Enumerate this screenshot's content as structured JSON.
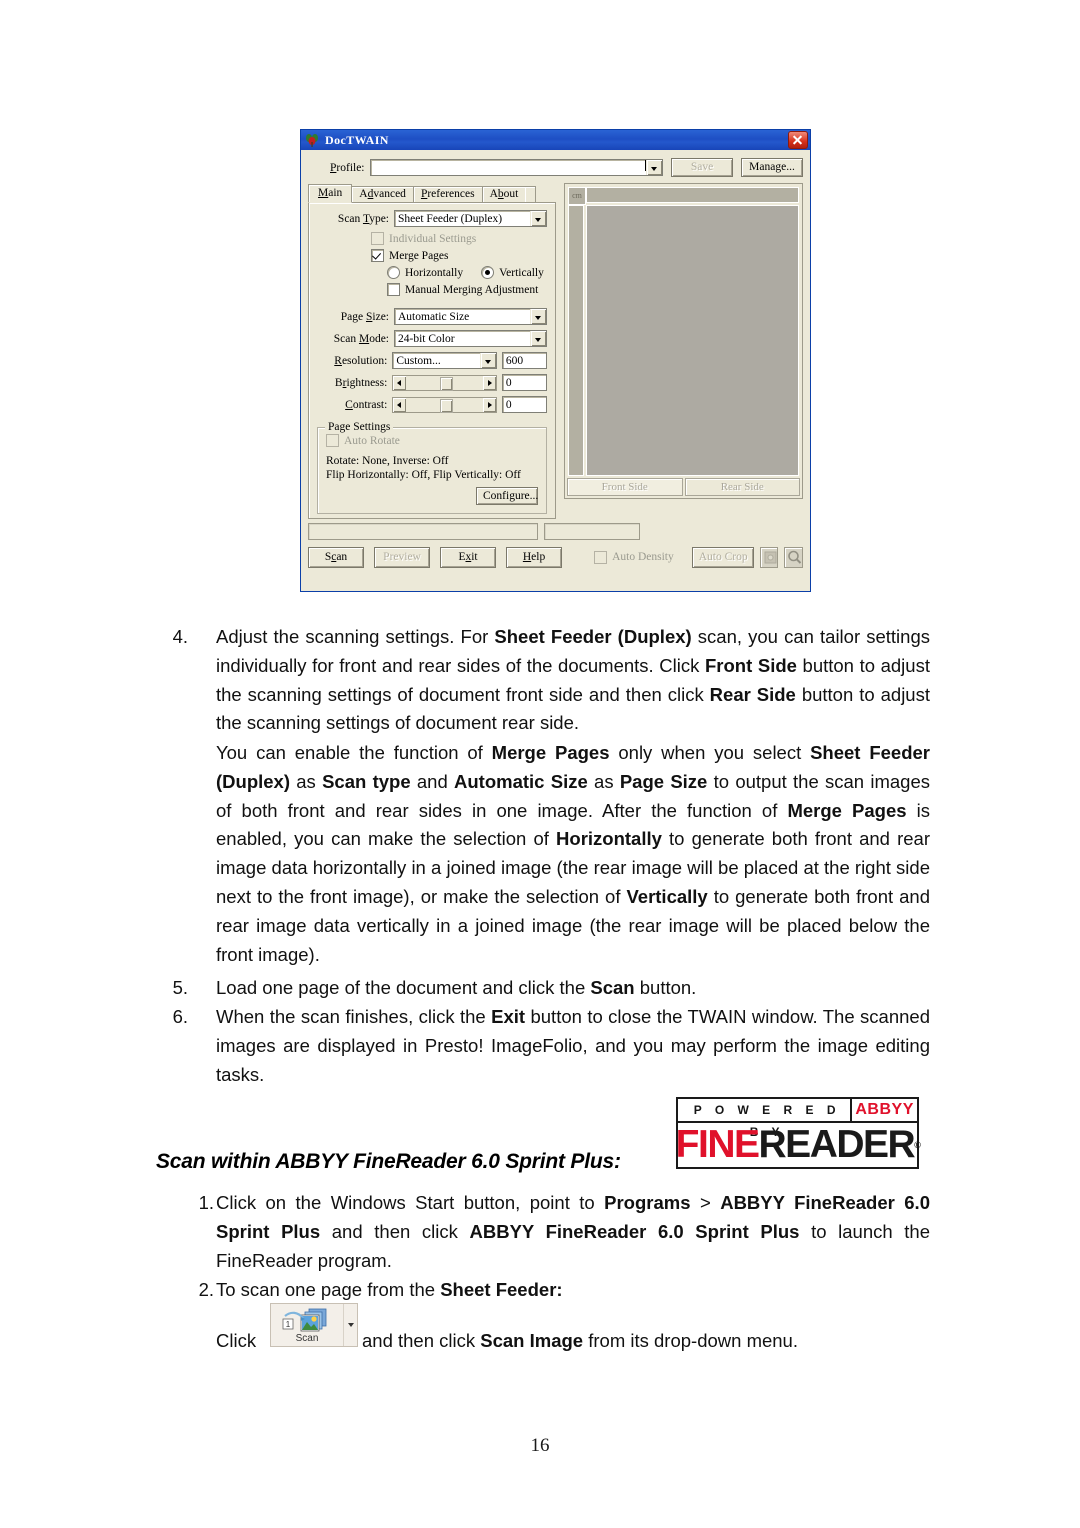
{
  "dialog": {
    "title": "DocTWAIN",
    "close_label": "Close",
    "profile_label": "Profile:",
    "profile_value": "",
    "save_label": "Save",
    "manage_label": "Manage...",
    "tabs": [
      {
        "label": "Main",
        "active": true
      },
      {
        "label": "Advanced",
        "active": false
      },
      {
        "label": "Preferences",
        "active": false
      },
      {
        "label": "About",
        "active": false
      }
    ],
    "main_tab": {
      "scan_type_label": "Scan Type:",
      "scan_type_value": "Sheet Feeder (Duplex)",
      "individual_settings_label": "Individual Settings",
      "individual_settings_checked": false,
      "merge_pages_label": "Merge Pages",
      "merge_pages_checked": true,
      "horizontally_label": "Horizontally",
      "vertically_label": "Vertically",
      "merge_direction_selected": "Vertically",
      "manual_merging_label": "Manual Merging Adjustment",
      "manual_merging_checked": false,
      "page_size_label": "Page Size:",
      "page_size_value": "Automatic Size",
      "scan_mode_label": "Scan Mode:",
      "scan_mode_value": "24-bit Color",
      "resolution_label": "Resolution:",
      "resolution_value": "Custom...",
      "resolution_dpi": "600",
      "brightness_label": "Brightness:",
      "brightness_value": "0",
      "contrast_label": "Contrast:",
      "contrast_value": "0",
      "page_settings": {
        "group_title": "Page Settings",
        "auto_rotate_label": "Auto Rotate",
        "auto_rotate_checked": false,
        "rotate_summary": "Rotate: None, Inverse: Off",
        "flip_summary": "Flip Horizontally: Off, Flip Vertically: Off",
        "configure_label": "Configure..."
      }
    },
    "preview": {
      "ruler_unit": "cm",
      "front_side_label": "Front Side",
      "rear_side_label": "Rear Side"
    },
    "status": {
      "left_text": "",
      "right_text": ""
    },
    "bottom": {
      "scan_label": "Scan",
      "preview_label": "Preview",
      "exit_label": "Exit",
      "help_label": "Help",
      "auto_density_label": "Auto Density",
      "auto_density_checked": false,
      "auto_crop_label": "Auto Crop"
    }
  },
  "document": {
    "item4": {
      "number": "4.",
      "segments": [
        {
          "t": "Adjust the scanning settings.  For ",
          "b": false
        },
        {
          "t": "Sheet Feeder (Duplex)",
          "b": true
        },
        {
          "t": " scan, you can tailor settings individually for front and rear sides of the documents.  Click ",
          "b": false
        },
        {
          "t": "Front Side",
          "b": true
        },
        {
          "t": " button to adjust the scanning settings of document front side and then click ",
          "b": false
        },
        {
          "t": "Rear Side",
          "b": true
        },
        {
          "t": " button to adjust the scanning settings of document rear side.",
          "b": false
        }
      ]
    },
    "item4b": {
      "segments": [
        {
          "t": "You can enable the function of ",
          "b": false
        },
        {
          "t": "Merge Pages",
          "b": true
        },
        {
          "t": " only when you select ",
          "b": false
        },
        {
          "t": "Sheet Feeder (Duplex)",
          "b": true
        },
        {
          "t": " as ",
          "b": false
        },
        {
          "t": "Scan type",
          "b": true
        },
        {
          "t": " and ",
          "b": false
        },
        {
          "t": "Automatic Size",
          "b": true
        },
        {
          "t": " as ",
          "b": false
        },
        {
          "t": "Page Size",
          "b": true
        },
        {
          "t": " to output the scan images of both front and rear sides in one image.  After the function of ",
          "b": false
        },
        {
          "t": "Merge Pages",
          "b": true
        },
        {
          "t": " is enabled, you can make the selection of ",
          "b": false
        },
        {
          "t": "Horizontally",
          "b": true
        },
        {
          "t": " to generate both front and rear image data horizontally in a joined image (the rear image will be placed at the right side next to the front image), or make the selection of ",
          "b": false
        },
        {
          "t": "Vertically",
          "b": true
        },
        {
          "t": " to generate both front and rear image data vertically in a joined image (the rear image will be placed below the front image).",
          "b": false
        }
      ]
    },
    "item5": {
      "number": "5.",
      "segments": [
        {
          "t": "Load one page of the document and click the ",
          "b": false
        },
        {
          "t": "Scan",
          "b": true
        },
        {
          "t": " button.",
          "b": false
        }
      ]
    },
    "item6": {
      "number": "6.",
      "segments": [
        {
          "t": "When the scan finishes, click the ",
          "b": false
        },
        {
          "t": "Exit",
          "b": true
        },
        {
          "t": " button to close the TWAIN window.  The scanned images are displayed in Presto! ImageFolio, and you may perform the image editing tasks.",
          "b": false
        }
      ]
    },
    "section_heading": "Scan within ABBYY FineReader 6.0 Sprint Plus:",
    "item1": {
      "number": "1.",
      "segments": [
        {
          "t": "Click on the Windows Start button, point to ",
          "b": false
        },
        {
          "t": "Programs",
          "b": true
        },
        {
          "t": " > ",
          "b": false
        },
        {
          "t": "ABBYY FineReader 6.0 Sprint Plus",
          "b": true
        },
        {
          "t": " and then click ",
          "b": false
        },
        {
          "t": "ABBYY FineReader 6.0 Sprint Plus",
          "b": true
        },
        {
          "t": " to launch the FineReader program.",
          "b": false
        }
      ]
    },
    "item2": {
      "number": "2.",
      "segments": [
        {
          "t": "To scan one page from the ",
          "b": false
        },
        {
          "t": "Sheet Feeder:",
          "b": true
        }
      ]
    },
    "click_line": {
      "prefix": "Click",
      "segments": [
        {
          "t": "and then click ",
          "b": false
        },
        {
          "t": "Scan Image",
          "b": true
        },
        {
          "t": " from its drop-down menu.",
          "b": false
        }
      ]
    },
    "scan_button": {
      "label": "Scan"
    },
    "page_number": "16"
  },
  "abbyy_logo": {
    "powered_by": "P O W E R E D   B Y",
    "brand": "ABBYY",
    "product_first": "FINE",
    "product_second": "READER",
    "registered": "®",
    "red": "#e0112b",
    "black": "#1a1a1a"
  }
}
